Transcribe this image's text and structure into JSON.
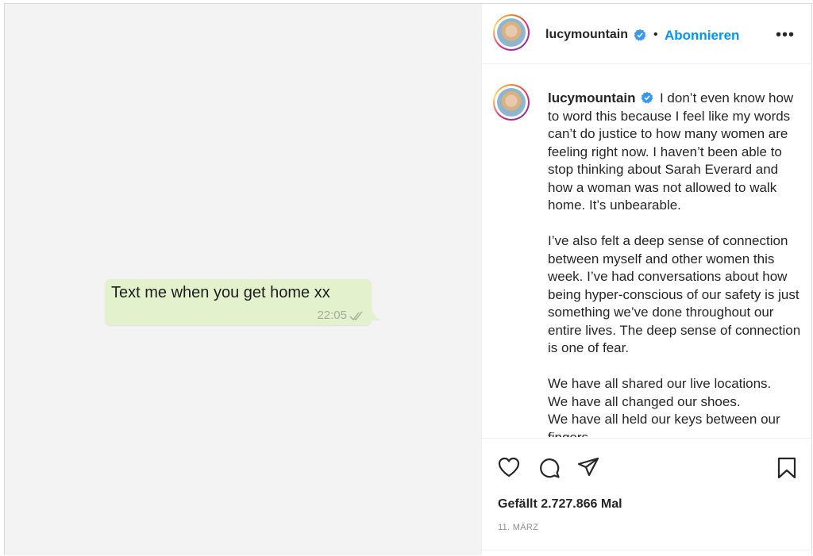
{
  "header": {
    "username": "lucymountain",
    "separator": "•",
    "follow_label": "Abonnieren",
    "more_label": "•••"
  },
  "media": {
    "message_text": "Text me when you get home xx",
    "message_time": "22:05",
    "bubble_color": "#e3f2cd"
  },
  "caption": {
    "username": "lucymountain",
    "paragraph1": "I don’t even know how to word this because I feel like my words can’t do justice to how many women are feeling right now. I haven’t been able to stop thinking about Sarah Everard and how a woman was not allowed to walk home. It’s unbearable.",
    "paragraph2": "I’ve also felt a deep sense of connection between myself and other women this week. I’ve had conversations about how being hyper-conscious of our safety is just something we’ve done throughout our entire lives. The deep sense of connection is one of fear.",
    "line1": "We have all shared our live locations.",
    "line2": "We have all changed our shoes.",
    "line3": "We have all held our keys between our fingers."
  },
  "actions": {
    "icons": [
      "heart-icon",
      "comment-icon",
      "share-icon",
      "bookmark-icon"
    ],
    "likes_text": "Gefällt 2.727.866 Mal",
    "date_text": "11. MÄRZ"
  },
  "colors": {
    "accent": "#0095f6",
    "verified": "#3897f0",
    "text": "#262626",
    "muted": "#8e8e8e"
  }
}
